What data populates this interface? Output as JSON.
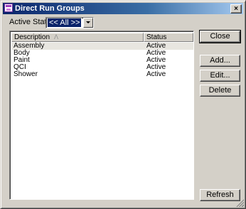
{
  "window": {
    "title": "Direct Run Groups",
    "close_glyph": "×"
  },
  "filter": {
    "label": "Active Status",
    "selected": "<< All >>"
  },
  "list": {
    "columns": [
      "Description",
      "Status"
    ],
    "sort_indicator": "Λ",
    "rows": [
      {
        "description": "Assembly",
        "status": "Active"
      },
      {
        "description": "Body",
        "status": "Active"
      },
      {
        "description": "Paint",
        "status": "Active"
      },
      {
        "description": "QCI",
        "status": "Active"
      },
      {
        "description": "Shower",
        "status": "Active"
      }
    ]
  },
  "buttons": {
    "close": "Close",
    "add": "Add...",
    "edit": "Edit...",
    "delete": "Delete",
    "refresh": "Refresh"
  },
  "icons": {
    "app": "window-app-icon",
    "close": "close-icon",
    "dropdown": "chevron-down-icon",
    "sort": "sort-ascending-icon",
    "grip": "size-grip-icon"
  }
}
